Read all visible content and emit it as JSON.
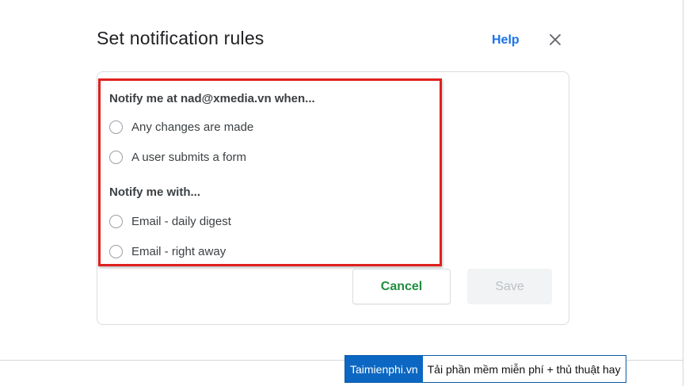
{
  "dialog": {
    "title": "Set notification rules",
    "help_label": "Help",
    "close_icon": "close-icon"
  },
  "rules": {
    "trigger_heading": "Notify me at nad@xmedia.vn when...",
    "trigger_options": [
      {
        "label": "Any changes are made",
        "selected": false
      },
      {
        "label": "A user submits a form",
        "selected": false
      }
    ],
    "method_heading": "Notify me with...",
    "method_options": [
      {
        "label": "Email - daily digest",
        "selected": false
      },
      {
        "label": "Email - right away",
        "selected": false
      }
    ]
  },
  "actions": {
    "cancel_label": "Cancel",
    "save_label": "Save",
    "save_enabled": false
  },
  "watermark": {
    "brand": "Taimienphi.vn",
    "tagline": "Tải phần mềm miễn phí + thủ thuật hay"
  },
  "colors": {
    "help_link": "#1a73e8",
    "cancel_text": "#1e8e3e",
    "highlight_border": "#e0201e",
    "watermark_brand_bg": "#0b67c2"
  }
}
